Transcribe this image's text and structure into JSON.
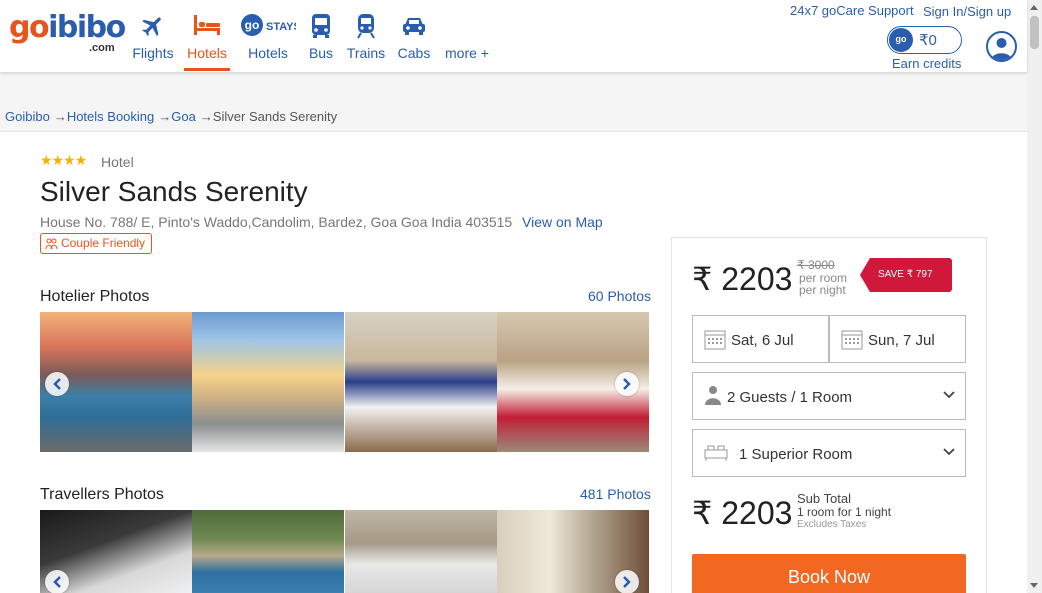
{
  "header": {
    "logo": {
      "go": "go",
      "ibibo": "ibibo",
      "com": ".com"
    },
    "nav": [
      {
        "label": "Flights",
        "icon": "airplane-icon"
      },
      {
        "label": "Hotels",
        "icon": "bed-icon",
        "active": true
      },
      {
        "label": "Hotels",
        "icon": "gostays-icon",
        "badge": "go",
        "badge_text": "STAYS"
      },
      {
        "label": "Bus",
        "icon": "bus-icon"
      },
      {
        "label": "Trains",
        "icon": "train-icon"
      },
      {
        "label": "Cabs",
        "icon": "car-icon"
      },
      {
        "label": "more +",
        "icon": ""
      }
    ],
    "support_link": "24x7 goCare Support",
    "signin_link": "Sign In/Sign up",
    "wallet": {
      "badge": "go",
      "amount": "₹0"
    },
    "earn_credits": "Earn credits"
  },
  "breadcrumb": [
    {
      "label": "Goibibo",
      "link": true
    },
    {
      "label": "Hotels Booking",
      "link": true
    },
    {
      "label": "Goa",
      "link": true
    },
    {
      "label": "Silver Sands Serenity",
      "link": false
    }
  ],
  "breadcrumb_arrow": "→",
  "hotel": {
    "stars": "★★★★",
    "type": "Hotel",
    "name": "Silver Sands Serenity",
    "address": "House No. 788/ E, Pinto's Waddo,Candolim, Bardez, Goa Goa India 403515",
    "map_link": "View on Map",
    "tag": "Couple Friendly"
  },
  "hotelier_photos": {
    "title": "Hotelier Photos",
    "link": "60 Photos"
  },
  "traveller_photos": {
    "title": "Travellers Photos",
    "link": "481 Photos"
  },
  "booking": {
    "currency": "₹",
    "price": "2203",
    "old_price": "₹ 3000",
    "per_room": "per room",
    "per_night": "per night",
    "save": "SAVE ₹ 797",
    "checkin": "Sat, 6 Jul",
    "checkout": "Sun, 7 Jul",
    "guests": "2 Guests / 1 Room",
    "room_type": "1 Superior Room",
    "subtotal_price": "2203",
    "subtotal_label": "Sub Total",
    "subtotal_detail": "1 room for 1 night",
    "excludes": "Excludes Taxes",
    "book_button": "Book Now"
  },
  "colors": {
    "brand_blue": "#2a5db0",
    "brand_orange": "#e8541d",
    "save_red": "#d0193a",
    "book_orange": "#f26722"
  }
}
